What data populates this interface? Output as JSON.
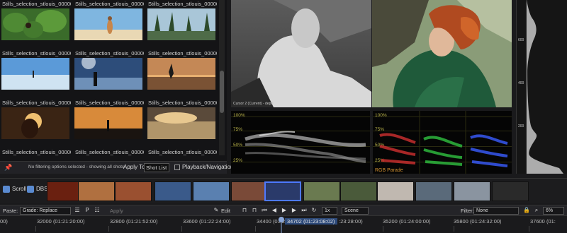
{
  "gallery": {
    "items": [
      {
        "label": "Stills_selection_stlouis_0000036.jp",
        "thumb": "thumb-1"
      },
      {
        "label": "Stills_selection_stlouis_0000037.jp",
        "thumb": "thumb-2"
      },
      {
        "label": "Stills_selection_stlouis_0000038.jp",
        "thumb": "thumb-3"
      },
      {
        "label": "Stills_selection_stlouis_0000039.jp",
        "thumb": "thumb-4"
      },
      {
        "label": "Stills_selection_stlouis_0000040.jp",
        "thumb": "thumb-5"
      },
      {
        "label": "Stills_selection_stlouis_0000041.jp",
        "thumb": "thumb-6"
      },
      {
        "label": "Stills_selection_stlouis_0000042.jp",
        "thumb": "thumb-7"
      },
      {
        "label": "Stills_selection_stlouis_0000044.jp",
        "thumb": "thumb-8"
      },
      {
        "label": "Stills_selection_stlouis_0000045.jp",
        "thumb": "thumb-9"
      },
      {
        "label": "Stills_selection_stlouis_0000046.jp",
        "thumb": "thumb-10"
      },
      {
        "label": "Stills_selection_stlouis_0000047.jp",
        "thumb": "thumb-11"
      },
      {
        "label": "Stills_selection_stlouis_0000048.jp",
        "thumb": "thumb-12"
      }
    ],
    "filter_text": "No filtering options selected - showing all shots",
    "apply_to_label": "Apply To:",
    "apply_to_value": "Shot List",
    "playback_label": "Playback/Navigation",
    "pin_icon": "pin-icon"
  },
  "viewer": {
    "depth_caption": "Cursor 2 (Current) - depth"
  },
  "histogram": {
    "ticks": [
      "600",
      "400",
      "200"
    ]
  },
  "scopes": {
    "waveform_labels": [
      "100%",
      "75%",
      "50%",
      "25%"
    ],
    "parade_labels": [
      "100%",
      "75%",
      "50%",
      "25%"
    ],
    "parade_caption": "RGB Parade",
    "parade_colors": [
      "#d03030",
      "#30c040",
      "#3a5cff"
    ]
  },
  "strip": {
    "scroll_label": "Scroll",
    "dbs_label": "DBS",
    "selected_index": 7
  },
  "toolbar": {
    "paste_label": "Paste:",
    "paste_value": "Grade: Replace",
    "apply_label": "Apply",
    "edit_label": "Edit",
    "speed_value": "1x",
    "scene_value": "Scene",
    "filter_label": "Filter:",
    "filter_value": "None",
    "zoom_value": "6%"
  },
  "timeline": {
    "timecodes": [
      "32000 (01:21:20:00)",
      "32800 (01:21:52:00)",
      "33600 (01:22:24:00)",
      "34400 (01:22",
      "34702 (01:23:08:02)",
      ":23:28:00)",
      "35200 (01:24:00:00)",
      "35800 (01:24:32:00)",
      "37600 (01:"
    ],
    "first_fragment": "00)"
  }
}
